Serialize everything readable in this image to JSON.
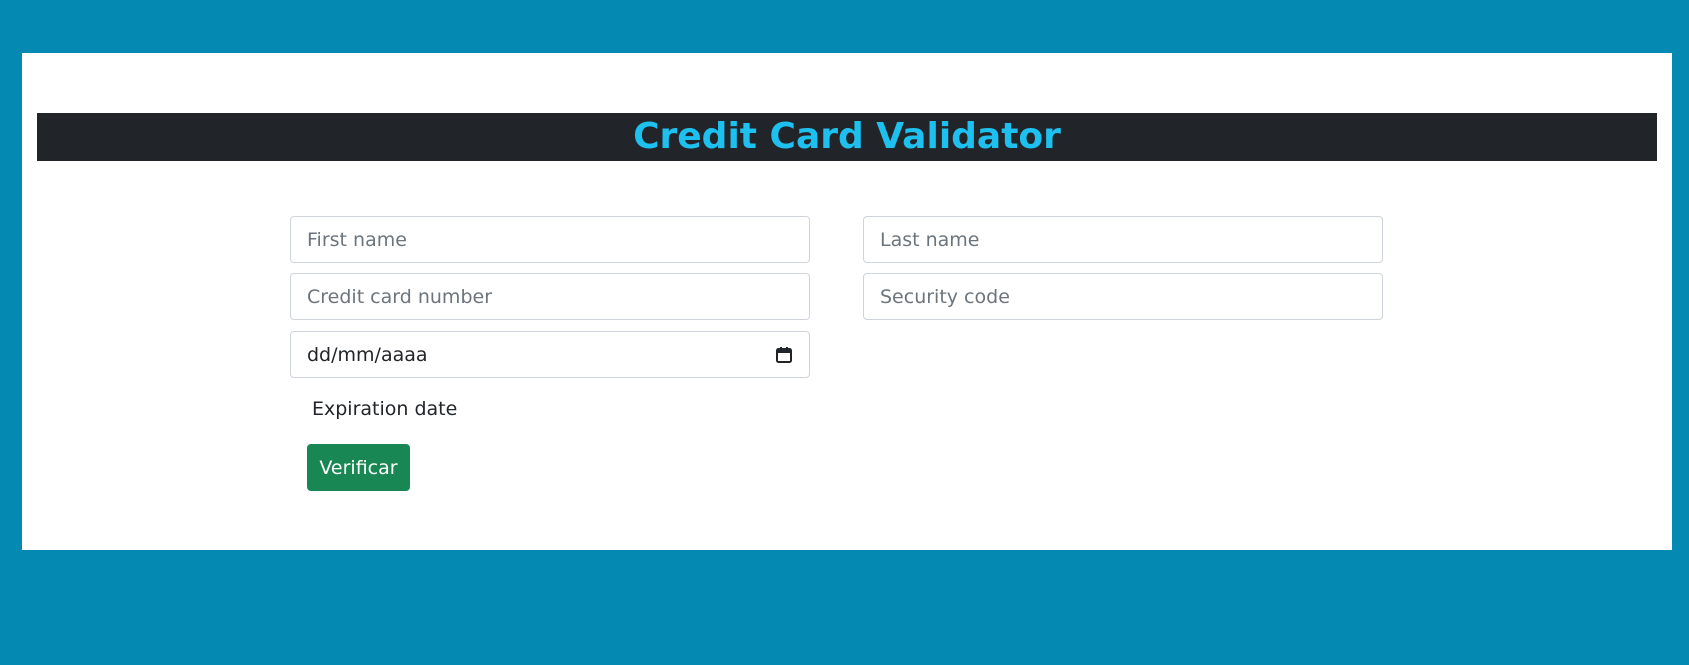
{
  "header": {
    "title": "Credit Card Validator"
  },
  "form": {
    "first_name": {
      "placeholder": "First name",
      "value": ""
    },
    "last_name": {
      "placeholder": "Last name",
      "value": ""
    },
    "card_number": {
      "placeholder": "Credit card number",
      "value": ""
    },
    "security_code": {
      "placeholder": "Security code",
      "value": ""
    },
    "expiration": {
      "display_value": "dd/mm/aaaa",
      "label": "Expiration date",
      "icon": "calendar-icon"
    },
    "submit_label": "Verificar"
  },
  "colors": {
    "page_background": "#0389b2",
    "title_bar": "#212529",
    "title_text": "#1ec0f0",
    "button": "#198754"
  }
}
